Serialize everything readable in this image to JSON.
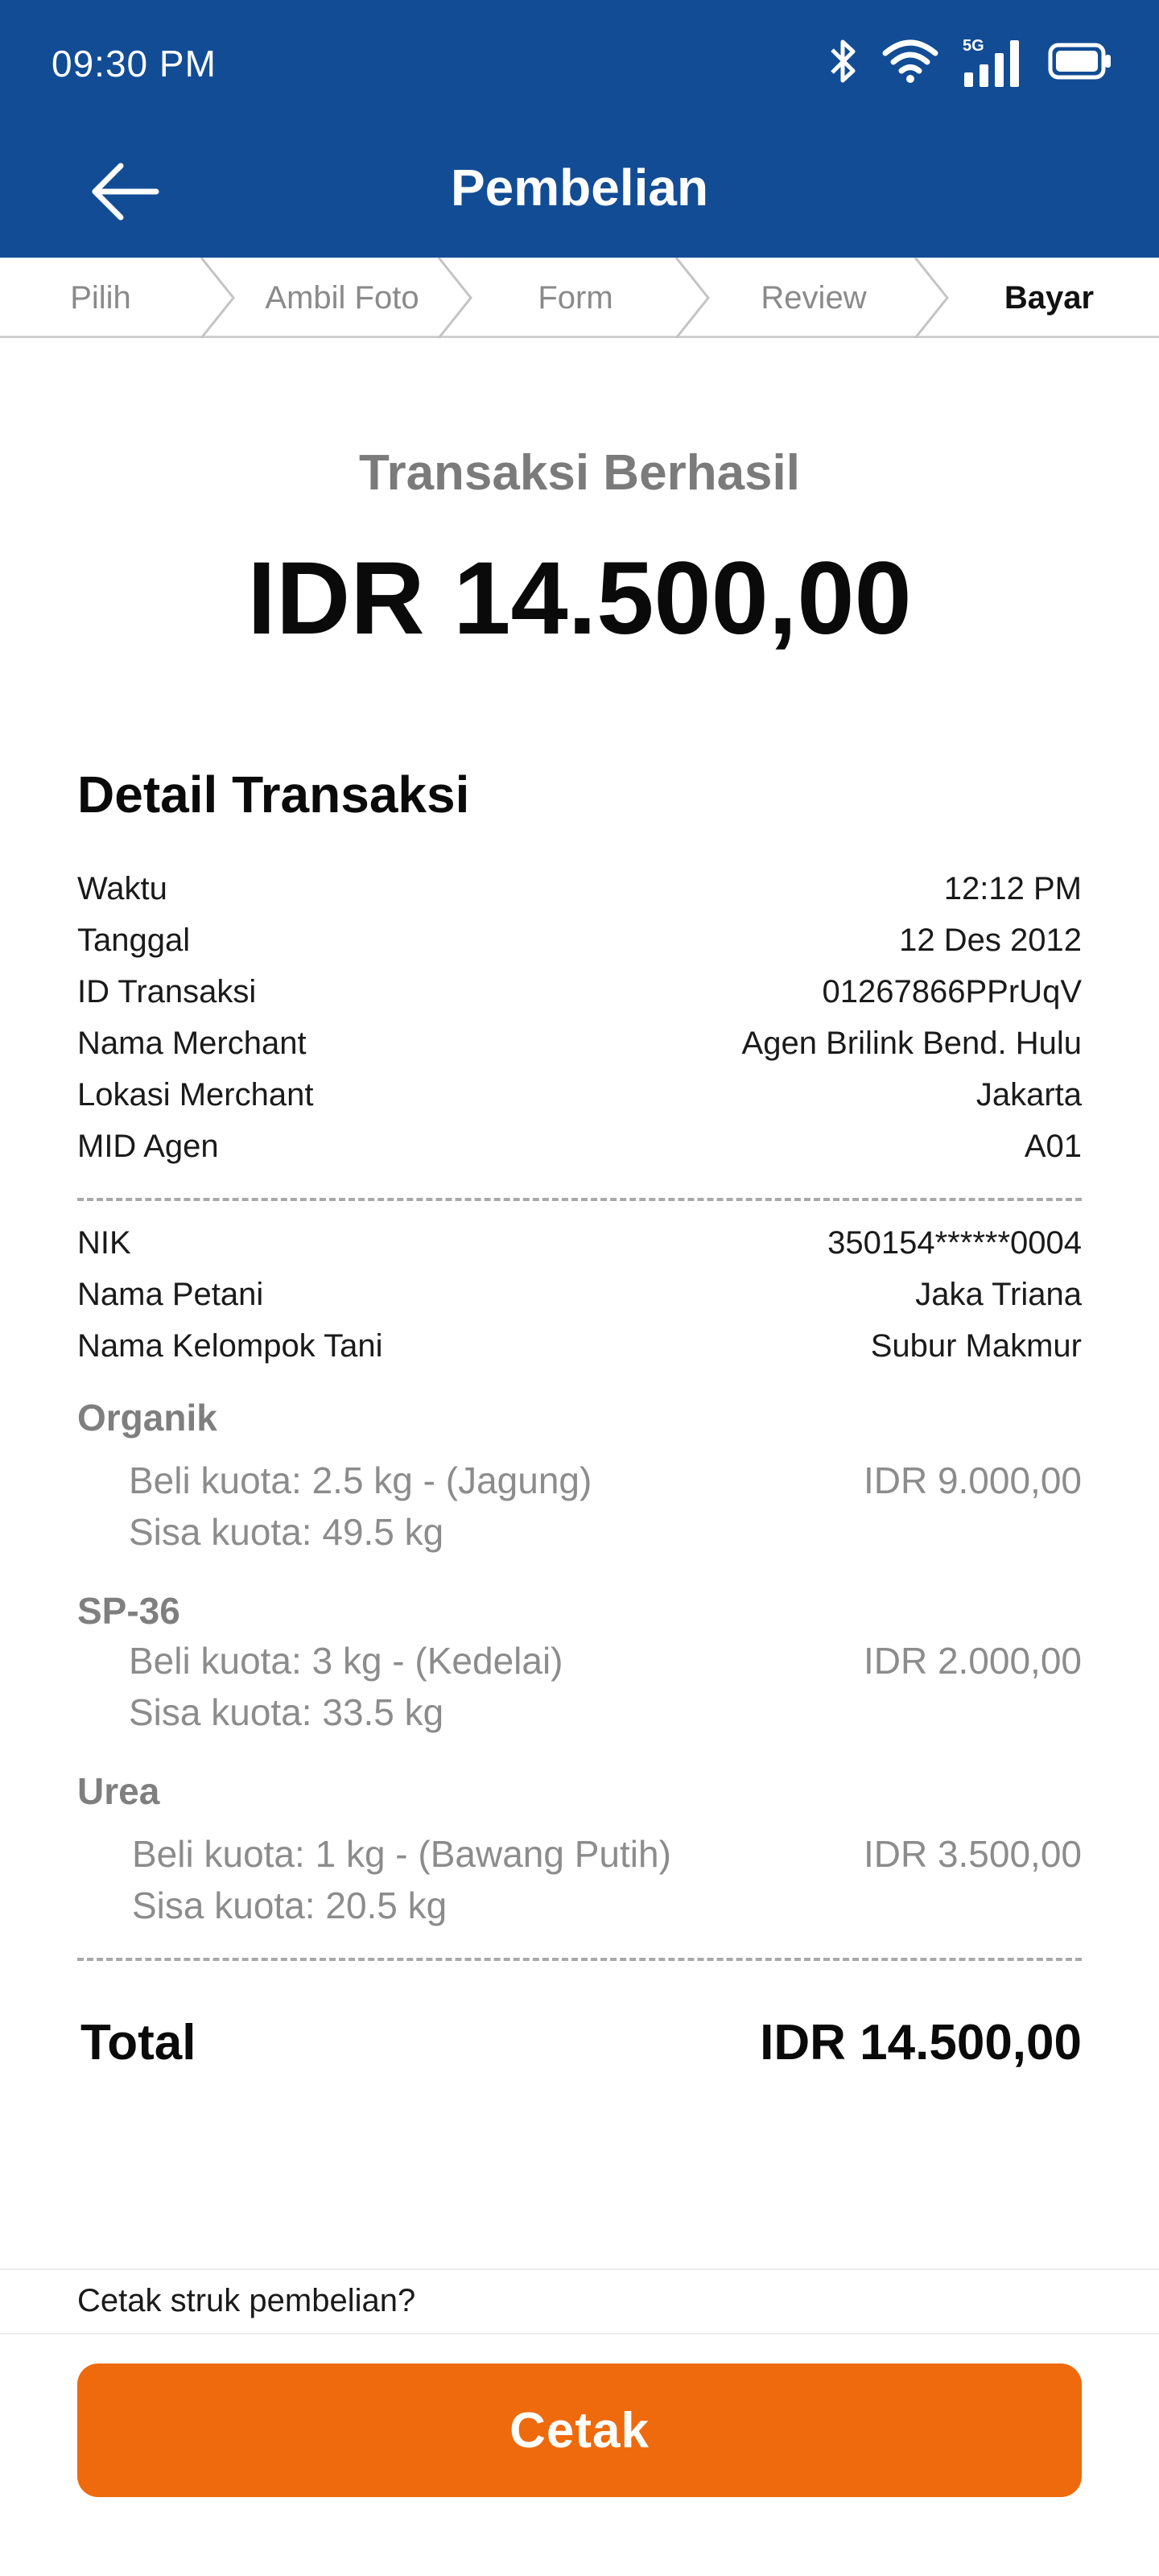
{
  "status_bar": {
    "time": "09:30 PM",
    "network_label": "5G",
    "icons": [
      "bluetooth-icon",
      "wifi-icon",
      "cellular-signal-icon",
      "battery-icon"
    ]
  },
  "app_bar": {
    "title": "Pembelian",
    "back_icon": "arrow-left-icon"
  },
  "stepper": {
    "steps": [
      {
        "label": "Pilih",
        "active": false
      },
      {
        "label": "Ambil Foto",
        "active": false
      },
      {
        "label": "Form",
        "active": false
      },
      {
        "label": "Review",
        "active": false
      },
      {
        "label": "Bayar",
        "active": true
      }
    ]
  },
  "summary": {
    "status": "Transaksi Berhasil",
    "amount": "IDR 14.500,00"
  },
  "detail": {
    "title": "Detail Transaksi",
    "rows": [
      {
        "label": "Waktu",
        "value": "12:12 PM"
      },
      {
        "label": "Tanggal",
        "value": "12 Des 2012"
      },
      {
        "label": "ID Transaksi",
        "value": "01267866PPrUqV"
      },
      {
        "label": "Nama Merchant",
        "value": "Agen Brilink Bend. Hulu"
      },
      {
        "label": "Lokasi Merchant",
        "value": "Jakarta"
      },
      {
        "label": "MID Agen",
        "value": "A01"
      }
    ],
    "farmer_rows": [
      {
        "label": "NIK",
        "value": "350154******0004"
      },
      {
        "label": "Nama Petani",
        "value": "Jaka Triana"
      },
      {
        "label": "Nama Kelompok Tani",
        "value": "Subur Makmur"
      }
    ],
    "items": [
      {
        "category": "Organik",
        "purchase": "Beli kuota: 2.5 kg - (Jagung)",
        "remaining": "Sisa kuota: 49.5 kg",
        "price": "IDR 9.000,00"
      },
      {
        "category": "SP-36",
        "purchase": "Beli kuota: 3 kg - (Kedelai)",
        "remaining": "Sisa kuota: 33.5 kg",
        "price": "IDR 2.000,00"
      },
      {
        "category": "Urea",
        "purchase": "Beli kuota: 1 kg - (Bawang Putih)",
        "remaining": "Sisa kuota: 20.5 kg",
        "price": "IDR 3.500,00"
      }
    ],
    "total_label": "Total",
    "total_value": "IDR 14.500,00"
  },
  "footer": {
    "print_question": "Cetak struk pembelian?",
    "print_button": "Cetak"
  },
  "colors": {
    "header_bg": "#124C95",
    "button_bg": "#EE6A0C"
  }
}
